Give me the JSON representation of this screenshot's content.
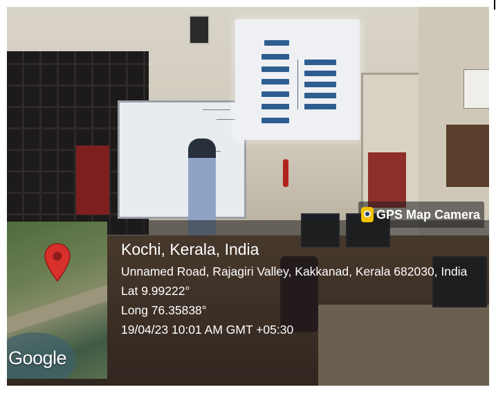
{
  "overlay": {
    "badge": {
      "label": "GPS Map Camera",
      "icon": "gps-camera-icon"
    },
    "location": {
      "title": "Kochi, Kerala, India",
      "address": "Unnamed Road, Rajagiri Valley, Kakkanad, Kerala 682030, India",
      "lat": "Lat 9.99222°",
      "long": "Long 76.35838°",
      "datetime": "19/04/23 10:01 AM GMT +05:30"
    },
    "map": {
      "provider": "Google",
      "pin_color": "#d8302b"
    }
  }
}
